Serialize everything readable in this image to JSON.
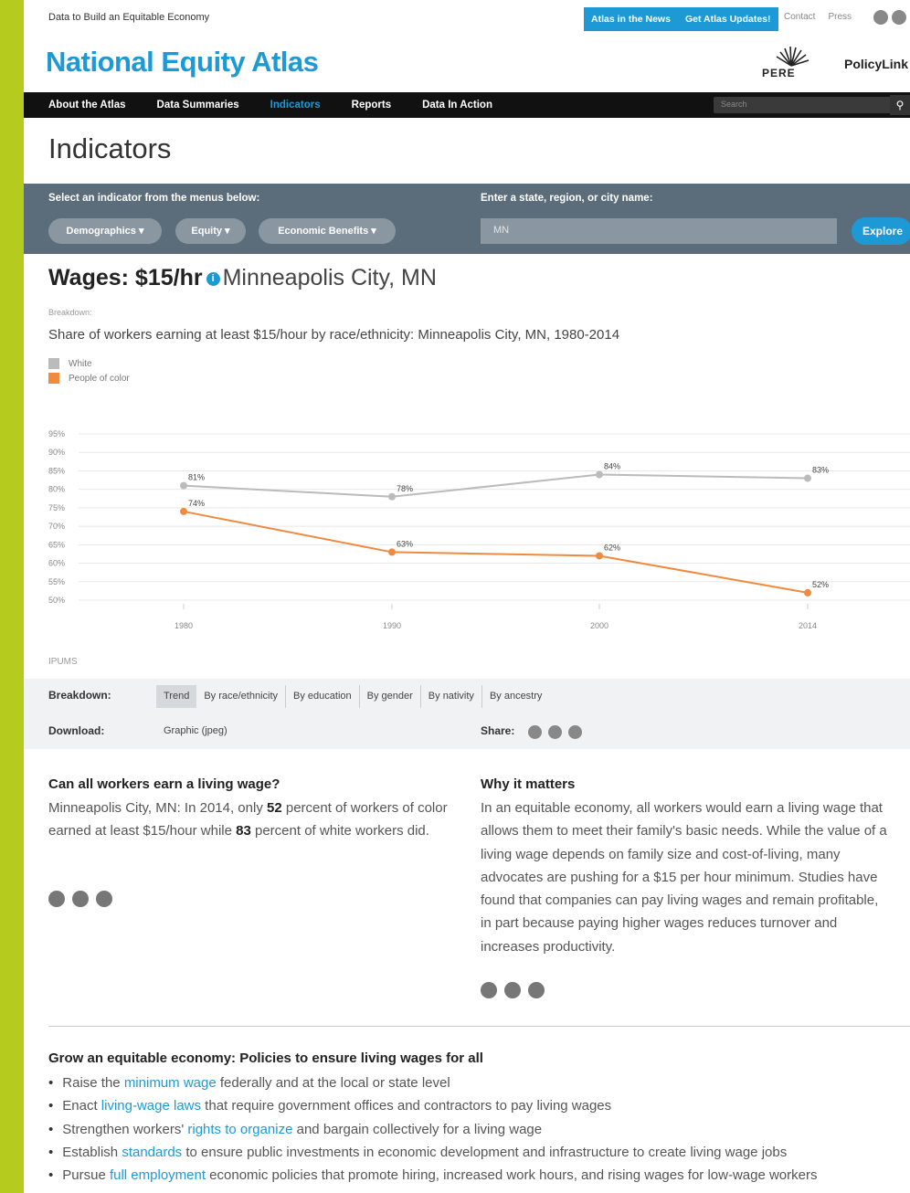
{
  "top": {
    "tagline": "Data to Build an Equitable Economy",
    "blue_buttons": [
      "Atlas in the News",
      "Get Atlas Updates!"
    ],
    "links": [
      "Contact",
      "Press"
    ]
  },
  "header": {
    "logo": "National Equity Atlas",
    "pere_label": "PERE",
    "policylink_label": "PolicyLink"
  },
  "nav": {
    "items": [
      "About the Atlas",
      "Data Summaries",
      "Indicators",
      "Reports",
      "Data In Action"
    ],
    "active": "Indicators",
    "search_placeholder": "Search"
  },
  "page_title": "Indicators",
  "selector": {
    "indicator_prompt": "Select an indicator from the menus below:",
    "place_prompt": "Enter a state, region, or city name:",
    "menus": [
      "Demographics ▾",
      "Equity ▾",
      "Economic Benefits ▾"
    ],
    "place_value": "MN",
    "explore_label": "Explore"
  },
  "indicator": {
    "name": "Wages: $15/hr",
    "place": "Minneapolis City, MN",
    "breakdown_small": "Breakdown:",
    "subtitle": "Share of workers earning at least $15/hour by race/ethnicity: Minneapolis City, MN, 1980-2014",
    "source": "IPUMS"
  },
  "chart_data": {
    "type": "line",
    "x": [
      "1980",
      "1990",
      "2000",
      "2014"
    ],
    "series": [
      {
        "name": "White",
        "values": [
          81,
          78,
          84,
          83
        ],
        "labels": [
          "81%",
          "78%",
          "84%",
          "83%"
        ],
        "color": "#bbbbbb"
      },
      {
        "name": "People of color",
        "values": [
          74,
          63,
          62,
          52
        ],
        "labels": [
          "74%",
          "63%",
          "62%",
          "52%"
        ],
        "color": "#f08a3e"
      }
    ],
    "yticks": [
      "95%",
      "90%",
      "85%",
      "80%",
      "75%",
      "70%",
      "65%",
      "60%",
      "55%",
      "50%"
    ],
    "ylim": [
      50,
      95
    ],
    "grid": true,
    "legend_position": "top-left"
  },
  "breakdown": {
    "label": "Breakdown:",
    "tabs": [
      "Trend",
      "By race/ethnicity",
      "By education",
      "By gender",
      "By nativity",
      "By ancestry"
    ],
    "active": "Trend"
  },
  "download": {
    "label": "Download:",
    "link": "Graphic (jpeg)",
    "share_label": "Share:"
  },
  "left_col": {
    "heading": "Can all workers earn a living wage?",
    "text_pre": "Minneapolis City, MN: In 2014, only ",
    "value_poc": "52",
    "text_mid": " percent of workers of color earned at least $15/hour while ",
    "value_white": "83",
    "text_post": " percent of white workers did."
  },
  "right_col": {
    "heading": "Why it matters",
    "text": "In an equitable economy, all workers would earn a living wage that allows them to meet their family's basic needs. While the value of a living wage depends on family size and cost-of-living, many advocates are pushing for a $15 per hour minimum. Studies have found that companies can pay living wages and remain profitable, in part because paying higher wages reduces turnover and increases productivity."
  },
  "policies": {
    "heading": "Grow an equitable economy: Policies to ensure living wages for all",
    "items": [
      {
        "pre": "Raise the ",
        "link": "minimum wage",
        "post": " federally and at the local or state level"
      },
      {
        "pre": "Enact ",
        "link": "living-wage laws",
        "post": " that require government offices and contractors to pay living wages"
      },
      {
        "pre": "Strengthen workers' ",
        "link": "rights to organize",
        "post": " and bargain collectively for a living wage"
      },
      {
        "pre": "Establish ",
        "link": "standards",
        "post": " to ensure public investments in economic development and infrastructure to create living wage jobs"
      },
      {
        "pre": "Pursue ",
        "link": "full employment",
        "post": " economic policies that promote hiring, increased work hours, and rising wages for low-wage workers"
      }
    ]
  }
}
